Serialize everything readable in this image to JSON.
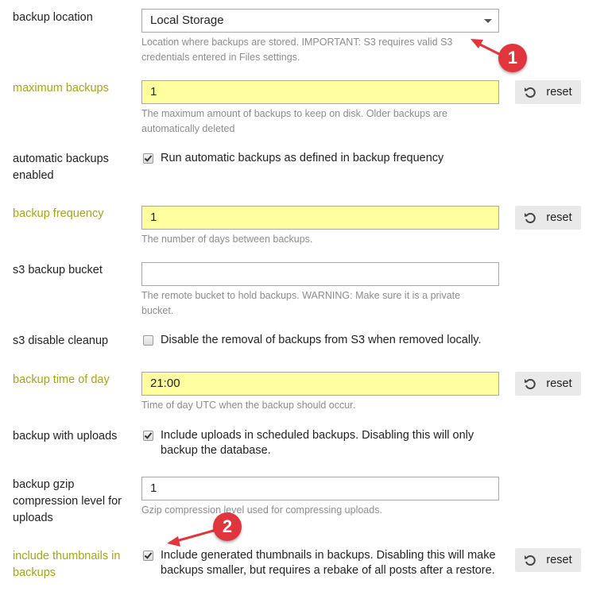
{
  "settings": [
    {
      "label": "backup location",
      "type": "select",
      "value": "Local Storage",
      "overridden": false,
      "desc": "Location where backups are stored. IMPORTANT: S3 requires valid S3 credentials entered in Files settings."
    },
    {
      "label": "maximum backups",
      "type": "text",
      "value": "1",
      "overridden": true,
      "desc": "The maximum amount of backups to keep on disk. Older backups are automatically deleted",
      "reset": "reset"
    },
    {
      "label": "automatic backups enabled",
      "type": "checkbox",
      "checked": true,
      "overridden": false,
      "text": "Run automatic backups as defined in backup frequency"
    },
    {
      "label": "backup frequency",
      "type": "text",
      "value": "1",
      "overridden": true,
      "desc": "The number of days between backups.",
      "reset": "reset"
    },
    {
      "label": "s3 backup bucket",
      "type": "text",
      "value": "",
      "overridden": false,
      "desc": "The remote bucket to hold backups. WARNING: Make sure it is a private bucket."
    },
    {
      "label": "s3 disable cleanup",
      "type": "checkbox",
      "checked": false,
      "overridden": false,
      "text": "Disable the removal of backups from S3 when removed locally."
    },
    {
      "label": "backup time of day",
      "type": "text",
      "value": "21:00",
      "overridden": true,
      "desc": "Time of day UTC when the backup should occur.",
      "reset": "reset"
    },
    {
      "label": "backup with uploads",
      "type": "checkbox",
      "checked": true,
      "overridden": false,
      "text": "Include uploads in scheduled backups. Disabling this will only backup the database."
    },
    {
      "label": "backup gzip compression level for uploads",
      "type": "text",
      "value": "1",
      "overridden": false,
      "desc": "Gzip compression level used for compressing uploads."
    },
    {
      "label": "include thumbnails in backups",
      "type": "checkbox",
      "checked": true,
      "overridden": true,
      "text": "Include generated thumbnails in backups. Disabling this will make backups smaller, but requires a rebake of all posts after a restore.",
      "reset": "reset"
    }
  ],
  "annotations": [
    {
      "number": "1",
      "color": "#e0353c"
    },
    {
      "number": "2",
      "color": "#e0353c"
    }
  ],
  "icons": {
    "reset": "undo-icon",
    "select_caret": "caret-down-icon"
  }
}
